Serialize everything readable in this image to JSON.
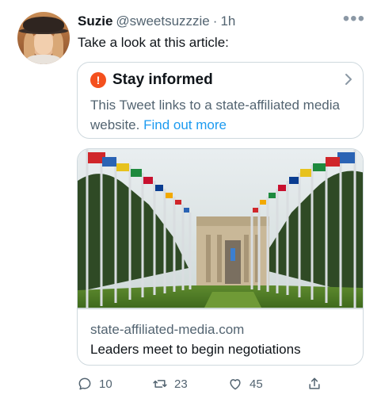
{
  "tweet": {
    "author_name": "Suzie",
    "author_handle": "@sweetsuzzzie",
    "separator": "·",
    "time": "1h",
    "more_label": "•••",
    "text": "Take a look at this article:"
  },
  "notice": {
    "title": "Stay informed",
    "icon": "warning-icon",
    "icon_glyph": "!",
    "body": "This Tweet links to a state-affiliated media website.",
    "link_text": "Find out more",
    "accent_color": "#1d9bf0",
    "warning_color": "#f4501e"
  },
  "card": {
    "image_subject": "flags-alley-building-photo",
    "domain": "state-affiliated-media.com",
    "headline": "Leaders meet to begin negotiations"
  },
  "actions": {
    "replies": "10",
    "retweets": "23",
    "likes": "45"
  }
}
